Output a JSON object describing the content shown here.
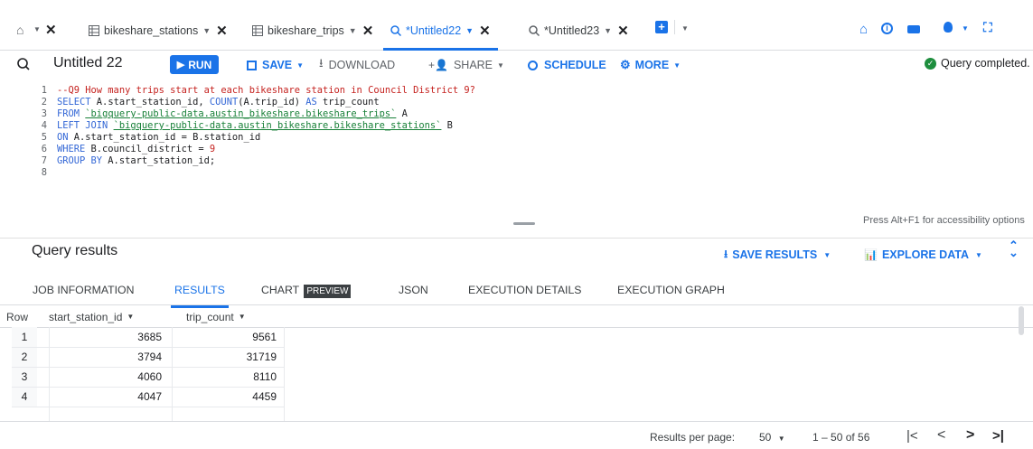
{
  "tabs": [
    {
      "label": "bikeshare_stations",
      "icon": "table-icon",
      "active": false
    },
    {
      "label": "bikeshare_trips",
      "icon": "table-icon",
      "active": false
    },
    {
      "label": "*Untitled22",
      "icon": "query-icon",
      "active": true
    },
    {
      "label": "*Untitled23",
      "icon": "query-icon",
      "active": false
    }
  ],
  "toolbar": {
    "title": "Untitled 22",
    "run": "RUN",
    "save": "SAVE",
    "download": "DOWNLOAD",
    "share": "SHARE",
    "schedule": "SCHEDULE",
    "more": "MORE",
    "status": "Query completed."
  },
  "editor": {
    "line_numbers": [
      "1",
      "2",
      "3",
      "4",
      "5",
      "6",
      "7",
      "8"
    ],
    "accessibility_hint": "Press Alt+F1 for accessibility options"
  },
  "results": {
    "title": "Query results",
    "save_results": "SAVE RESULTS",
    "explore_data": "EXPLORE DATA",
    "tabs": [
      "JOB INFORMATION",
      "RESULTS",
      "CHART",
      "JSON",
      "EXECUTION DETAILS",
      "EXECUTION GRAPH"
    ],
    "preview_badge": "PREVIEW",
    "columns": [
      "Row",
      "start_station_id",
      "trip_count"
    ],
    "rows": [
      [
        "1",
        "3685",
        "9561"
      ],
      [
        "2",
        "3794",
        "31719"
      ],
      [
        "3",
        "4060",
        "8110"
      ],
      [
        "4",
        "4047",
        "4459"
      ]
    ],
    "pagination": {
      "per_page_label": "Results per page:",
      "per_page_value": "50",
      "range": "1 – 50 of 56"
    }
  },
  "colors": {
    "accent": "#1a73e8",
    "success": "#1e8e3e"
  }
}
